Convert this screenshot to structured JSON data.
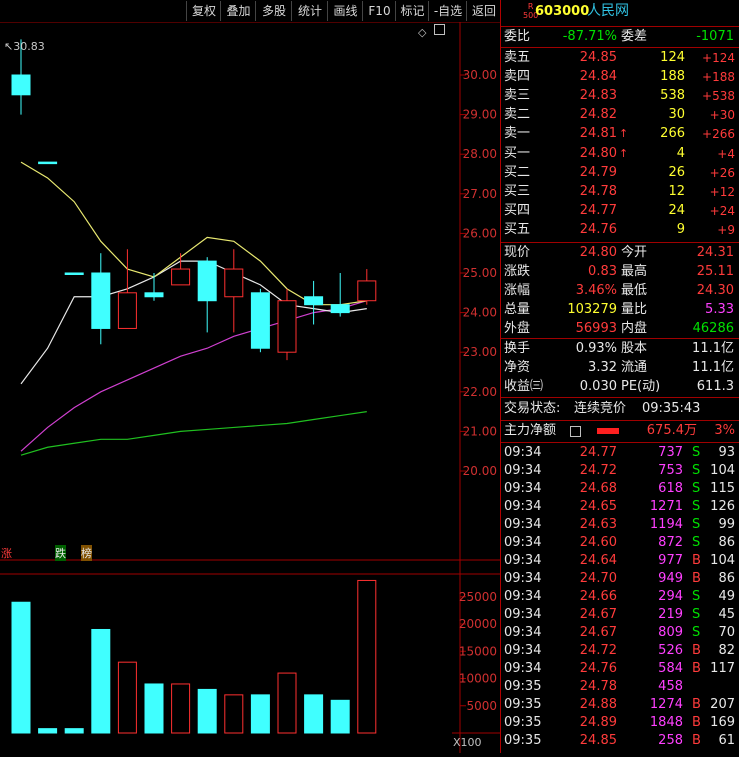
{
  "toolbar": [
    "复权",
    "叠加",
    "多股",
    "统计",
    "画线",
    "F10",
    "标记",
    "-自选",
    "返回"
  ],
  "stock": {
    "code": "603000",
    "name": "人民网",
    "badge_top": "R",
    "badge_bottom": "500"
  },
  "price_axis": [
    "30.00",
    "29.00",
    "28.00",
    "27.00",
    "26.00",
    "25.00",
    "24.00",
    "23.00",
    "22.00",
    "21.00",
    "20.00"
  ],
  "volume_axis": [
    "25000",
    "20000",
    "15000",
    "10000",
    "5000"
  ],
  "volume_unit": "X100",
  "chart_marker": "30.83",
  "chart_tags": [
    "涨",
    "跌",
    "榜"
  ],
  "weibi": {
    "label1": "委比",
    "value1": "-87.71%",
    "label2": "委差",
    "value2": "-1071"
  },
  "asks": [
    {
      "label": "卖五",
      "price": "24.85",
      "vol": "124",
      "chg": "+124",
      "arrow": ""
    },
    {
      "label": "卖四",
      "price": "24.84",
      "vol": "188",
      "chg": "+188",
      "arrow": ""
    },
    {
      "label": "卖三",
      "price": "24.83",
      "vol": "538",
      "chg": "+538",
      "arrow": ""
    },
    {
      "label": "卖二",
      "price": "24.82",
      "vol": "30",
      "chg": "+30",
      "arrow": ""
    },
    {
      "label": "卖一",
      "price": "24.81",
      "vol": "266",
      "chg": "+266",
      "arrow": "↑"
    }
  ],
  "bids": [
    {
      "label": "买一",
      "price": "24.80",
      "vol": "4",
      "chg": "+4",
      "arrow": "↑"
    },
    {
      "label": "买二",
      "price": "24.79",
      "vol": "26",
      "chg": "+26",
      "arrow": ""
    },
    {
      "label": "买三",
      "price": "24.78",
      "vol": "12",
      "chg": "+12",
      "arrow": ""
    },
    {
      "label": "买四",
      "price": "24.77",
      "vol": "24",
      "chg": "+24",
      "arrow": ""
    },
    {
      "label": "买五",
      "price": "24.76",
      "vol": "9",
      "chg": "+9",
      "arrow": ""
    }
  ],
  "quote": [
    {
      "l1": "现价",
      "v1": "24.80",
      "l2": "今开",
      "v2": "24.31"
    },
    {
      "l1": "涨跌",
      "v1": "0.83",
      "l2": "最高",
      "v2": "25.11"
    },
    {
      "l1": "涨幅",
      "v1": "3.46%",
      "l2": "最低",
      "v2": "24.30"
    },
    {
      "l1": "总量",
      "v1": "103279",
      "l2": "量比",
      "v2": "5.33"
    },
    {
      "l1": "外盘",
      "v1": "56993",
      "l2": "内盘",
      "v2": "46286"
    }
  ],
  "stats": [
    {
      "l1": "换手",
      "v1": "0.93%",
      "l2": "股本",
      "v2": "11.1亿"
    },
    {
      "l1": "净资",
      "v1": "3.32",
      "l2": "流通",
      "v2": "11.1亿"
    },
    {
      "l1": "收益㈢",
      "v1": "0.030",
      "l2": "PE(动)",
      "v2": "611.3"
    }
  ],
  "status": {
    "label": "交易状态:",
    "value": "连续竞价",
    "time": "09:35:43"
  },
  "mainflow": {
    "label": "主力净额",
    "value": "675.4万",
    "pct": "3%"
  },
  "ticks": [
    {
      "t": "09:34",
      "p": "24.77",
      "v": "737",
      "s": "S",
      "n": "93"
    },
    {
      "t": "09:34",
      "p": "24.72",
      "v": "753",
      "s": "S",
      "n": "104"
    },
    {
      "t": "09:34",
      "p": "24.68",
      "v": "618",
      "s": "S",
      "n": "115"
    },
    {
      "t": "09:34",
      "p": "24.65",
      "v": "1271",
      "s": "S",
      "n": "126"
    },
    {
      "t": "09:34",
      "p": "24.63",
      "v": "1194",
      "s": "S",
      "n": "99"
    },
    {
      "t": "09:34",
      "p": "24.60",
      "v": "872",
      "s": "S",
      "n": "86"
    },
    {
      "t": "09:34",
      "p": "24.64",
      "v": "977",
      "s": "B",
      "n": "104"
    },
    {
      "t": "09:34",
      "p": "24.70",
      "v": "949",
      "s": "B",
      "n": "86"
    },
    {
      "t": "09:34",
      "p": "24.66",
      "v": "294",
      "s": "S",
      "n": "49"
    },
    {
      "t": "09:34",
      "p": "24.67",
      "v": "219",
      "s": "S",
      "n": "45"
    },
    {
      "t": "09:34",
      "p": "24.67",
      "v": "809",
      "s": "S",
      "n": "70"
    },
    {
      "t": "09:34",
      "p": "24.72",
      "v": "526",
      "s": "B",
      "n": "82"
    },
    {
      "t": "09:34",
      "p": "24.76",
      "v": "584",
      "s": "B",
      "n": "117"
    },
    {
      "t": "09:35",
      "p": "24.78",
      "v": "458",
      "s": "",
      "n": ""
    },
    {
      "t": "09:35",
      "p": "24.88",
      "v": "1274",
      "s": "B",
      "n": "207"
    },
    {
      "t": "09:35",
      "p": "24.89",
      "v": "1848",
      "s": "B",
      "n": "169"
    },
    {
      "t": "09:35",
      "p": "24.85",
      "v": "258",
      "s": "B",
      "n": "61"
    }
  ],
  "chart_data": {
    "type": "candlestick",
    "price_range": [
      19.6,
      31.0
    ],
    "candles": [
      {
        "o": 30.0,
        "c": 29.5,
        "h": 30.9,
        "l": 29.0,
        "up": false
      },
      {
        "o": 27.8,
        "c": 27.8,
        "h": 27.8,
        "l": 27.8,
        "up": false
      },
      {
        "o": 25.0,
        "c": 25.0,
        "h": 25.0,
        "l": 25.0,
        "up": false
      },
      {
        "o": 25.0,
        "c": 23.6,
        "h": 25.5,
        "l": 23.2,
        "up": false
      },
      {
        "o": 23.6,
        "c": 24.5,
        "h": 25.6,
        "l": 23.6,
        "up": true
      },
      {
        "o": 24.5,
        "c": 24.4,
        "h": 25.0,
        "l": 24.3,
        "up": false
      },
      {
        "o": 24.7,
        "c": 25.1,
        "h": 25.5,
        "l": 24.7,
        "up": true
      },
      {
        "o": 25.3,
        "c": 24.3,
        "h": 25.4,
        "l": 23.5,
        "up": false
      },
      {
        "o": 24.4,
        "c": 25.1,
        "h": 25.6,
        "l": 23.5,
        "up": true
      },
      {
        "o": 24.5,
        "c": 23.1,
        "h": 24.6,
        "l": 23.0,
        "up": false
      },
      {
        "o": 23.0,
        "c": 24.3,
        "h": 24.6,
        "l": 22.8,
        "up": true
      },
      {
        "o": 24.4,
        "c": 24.2,
        "h": 24.8,
        "l": 23.7,
        "up": false
      },
      {
        "o": 24.0,
        "c": 24.2,
        "h": 25.0,
        "l": 23.9,
        "up": false
      },
      {
        "o": 24.3,
        "c": 24.8,
        "h": 25.1,
        "l": 24.2,
        "up": true
      }
    ],
    "ma_yellow": [
      27.8,
      27.4,
      26.8,
      25.8,
      25.1,
      24.9,
      25.4,
      25.9,
      25.8,
      25.3,
      24.6,
      24.2,
      24.2,
      24.3
    ],
    "ma_white": [
      22.2,
      23.1,
      24.4,
      24.4,
      24.6,
      24.9,
      25.3,
      25.3,
      25.0,
      24.7,
      24.2,
      24.1,
      24.0,
      24.1
    ],
    "ma_magenta": [
      20.5,
      21.1,
      21.6,
      22.0,
      22.3,
      22.6,
      22.9,
      23.1,
      23.4,
      23.6,
      23.8,
      24.0,
      24.1,
      24.3
    ],
    "ma_green": [
      20.4,
      20.6,
      20.7,
      20.8,
      20.8,
      20.9,
      21.0,
      21.05,
      21.1,
      21.15,
      21.2,
      21.3,
      21.4,
      21.5
    ],
    "volume_range": [
      0,
      29000
    ],
    "volumes": [
      24000,
      800,
      800,
      19000,
      13000,
      9000,
      9000,
      8000,
      7000,
      7000,
      11000,
      7000,
      6000,
      28000
    ]
  }
}
